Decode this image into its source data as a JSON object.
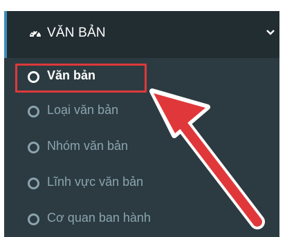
{
  "menu": {
    "header": {
      "label": "VĂN BẢN",
      "icon": "dashboard-icon",
      "toggle_icon": "chevron-down-icon",
      "expanded": true
    },
    "items": [
      {
        "label": "Văn bản",
        "active": true
      },
      {
        "label": "Loại văn bản",
        "active": false
      },
      {
        "label": "Nhóm văn bản",
        "active": false
      },
      {
        "label": "Lĩnh vực văn bản",
        "active": false
      },
      {
        "label": "Cơ quan ban hành",
        "active": false
      }
    ]
  },
  "annotation": {
    "highlight_color": "#e0383a",
    "pointer": "arrow-icon"
  },
  "colors": {
    "header_bg": "#222d32",
    "submenu_bg": "#2c3b41",
    "accent": "#3c8dbc",
    "muted_text": "#8aa4af"
  }
}
